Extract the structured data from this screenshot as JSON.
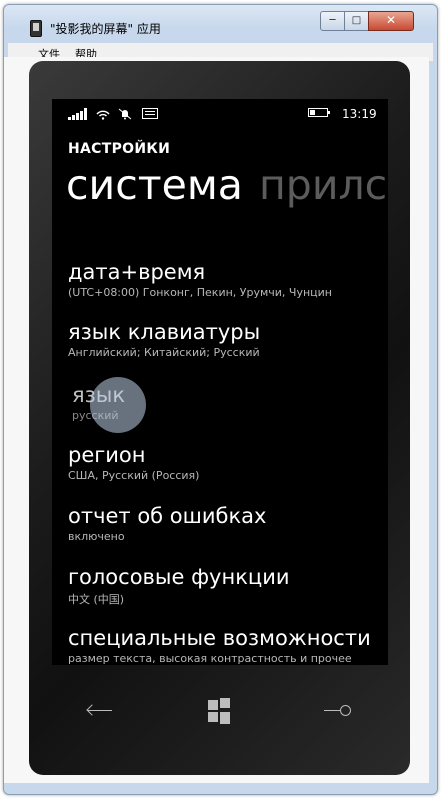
{
  "window": {
    "title": "\"投影我的屏幕\" 应用",
    "min_label": "─",
    "max_label": "□",
    "close_label": "✕"
  },
  "menu": {
    "items": [
      "文件",
      "帮助"
    ]
  },
  "status": {
    "time": "13:19",
    "icons": [
      "signal-icon",
      "wifi-icon",
      "quiet-hours-icon",
      "message-icon",
      "battery-icon"
    ]
  },
  "header": {
    "label": "НАСТРОЙКИ"
  },
  "pivot": {
    "active": "система",
    "next": "прилс"
  },
  "settings": [
    {
      "title": "дата+время",
      "subtitle": "(UTC+08:00) Гонконг, Пекин, Урумчи, Чунцин"
    },
    {
      "title": "язык клавиатуры",
      "subtitle": "Английский; Китайский; Русский"
    },
    {
      "title": "язык",
      "subtitle": "русский"
    },
    {
      "title": "регион",
      "subtitle": "США, Русский (Россия)"
    },
    {
      "title": "отчет об ошибках",
      "subtitle": "включено"
    },
    {
      "title": "голосовые функции",
      "subtitle": "中文 (中国)"
    },
    {
      "title": "специальные возможности",
      "subtitle": "размер текста, высокая контрастность и прочее"
    }
  ],
  "navigation": {
    "buttons": [
      "back-icon",
      "start-icon",
      "search-icon"
    ]
  },
  "colors": {
    "screen_bg": "#000000",
    "pivot_inactive": "#5c5c5c",
    "subtitle": "#b8b8b8"
  }
}
